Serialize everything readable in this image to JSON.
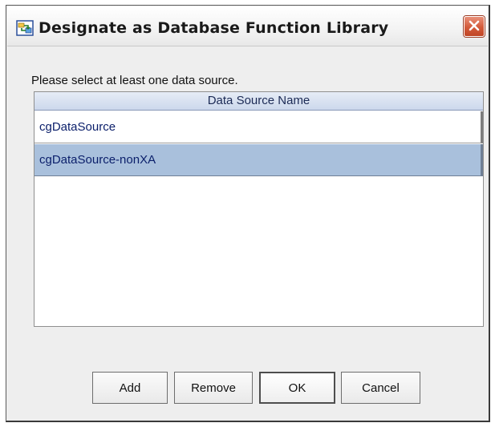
{
  "dialog": {
    "title": "Designate as Database Function Library",
    "icon": "function-library-icon",
    "close_icon": "close-icon"
  },
  "instruction": "Please select at least one data source.",
  "table": {
    "column_header": "Data Source Name",
    "rows": [
      {
        "name": "cgDataSource",
        "selected": false
      },
      {
        "name": "cgDataSource-nonXA",
        "selected": true
      }
    ],
    "selection_color": "#a9c0dc"
  },
  "buttons": {
    "add": "Add",
    "remove": "Remove",
    "ok": "OK",
    "cancel": "Cancel"
  }
}
